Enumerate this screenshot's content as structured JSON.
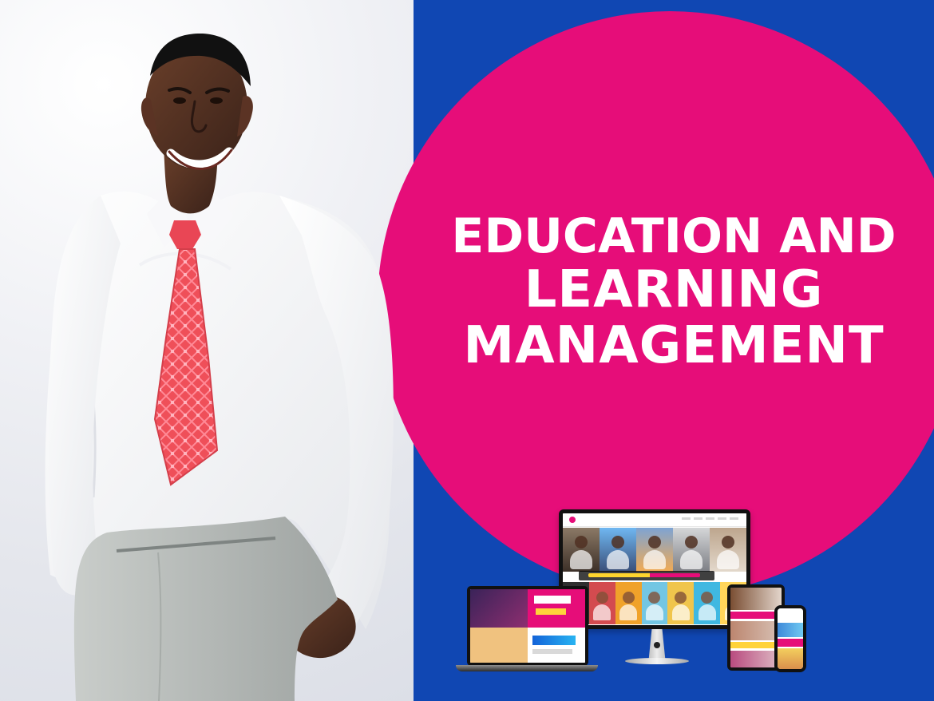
{
  "headline": {
    "line_1": "EDUCATION AND",
    "line_2": "LEARNING",
    "line_3": "MANAGEMENT"
  },
  "colors": {
    "background_blue": "#1047b3",
    "circle_pink": "#e60d79",
    "tie_red": "#ef4f59",
    "shirt_white": "#f7f7f7",
    "trousers_gray": "#b7bbb8"
  }
}
